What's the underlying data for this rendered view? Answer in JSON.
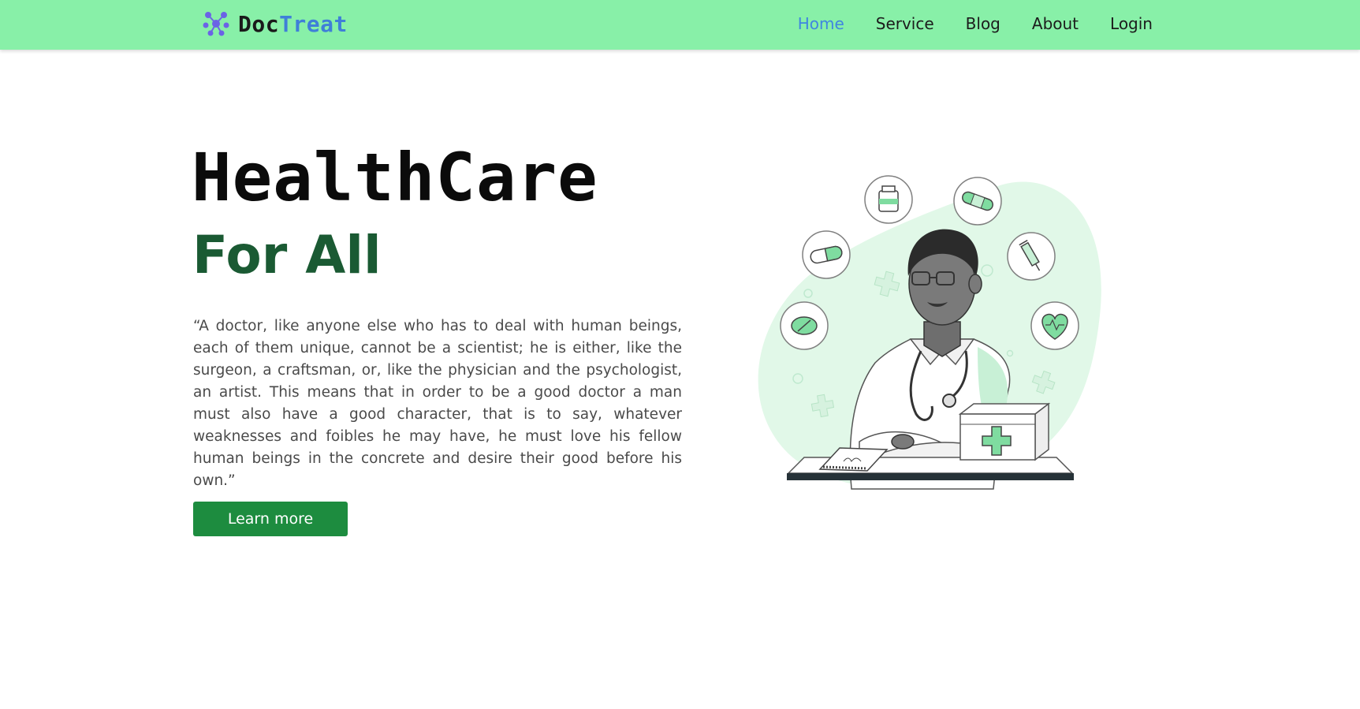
{
  "brand": {
    "name_part1": "Doc",
    "name_part2": "Treat",
    "logo_icon": "molecule-icon"
  },
  "nav": {
    "items": [
      {
        "label": "Home",
        "active": true
      },
      {
        "label": "Service",
        "active": false
      },
      {
        "label": "Blog",
        "active": false
      },
      {
        "label": "About",
        "active": false
      },
      {
        "label": "Login",
        "active": false
      }
    ]
  },
  "hero": {
    "title": "HealthCare",
    "subtitle": "For All",
    "quote": "“A doctor, like anyone else who has to deal with human beings, each of them unique, cannot be a scientist; he is either, like the surgeon, a craftsman, or, like the physician and the psychologist, an artist. This means that in order to be a good doctor a man must also have a good character, that is to say, whatever weaknesses and foibles he may have, he must love his fellow human beings in the concrete and desire their good before his own.”",
    "button_label": "Learn more"
  },
  "colors": {
    "navbar_bg": "#88f0a8",
    "nav_active": "#3f86e0",
    "brand_accent": "#3f7fd8",
    "subtitle": "#1a5a33",
    "button_bg": "#1d8c3f",
    "illustration_green": "#7fdca0"
  },
  "illustration": {
    "subject": "doctor-with-stethoscope",
    "icons": [
      "medicine-jar-icon",
      "bandage-icon",
      "capsule-icon",
      "syringe-icon",
      "pill-icon",
      "heart-pulse-icon",
      "first-aid-kit-icon",
      "notebook-icon"
    ]
  }
}
